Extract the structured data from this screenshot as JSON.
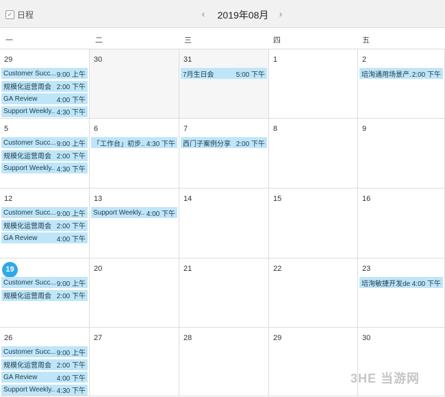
{
  "app": {
    "label": "日程",
    "icon": "check-square-icon"
  },
  "header": {
    "month": "2019年08月",
    "prev_icon": "‹",
    "next_icon": "›"
  },
  "weekdays": [
    "一",
    "二",
    "三",
    "四",
    "五"
  ],
  "colors": {
    "event_bg": "#bfe6f8",
    "today": "#32a8e6",
    "muted_cell": "#f6f6f6"
  },
  "weeks": [
    {
      "days": [
        {
          "day": "29",
          "muted": false,
          "events": [
            {
              "title": "Customer Succ...",
              "time": "9:00 上午"
            },
            {
              "title": "规模化运营周会",
              "time": "2:00 下午"
            },
            {
              "title": "GA Review",
              "time": "4:00 下午"
            },
            {
              "title": "Support Weekly...",
              "time": "4:30 下午"
            }
          ]
        },
        {
          "day": "30",
          "muted": true,
          "events": []
        },
        {
          "day": "31",
          "muted": true,
          "events": [
            {
              "title": "7月生日会",
              "time": "5:00 下午"
            }
          ]
        },
        {
          "day": "1",
          "muted": false,
          "events": []
        },
        {
          "day": "2",
          "muted": false,
          "events": [
            {
              "title": "培洵通用场景产...",
              "time": "2:00 下午"
            }
          ]
        }
      ]
    },
    {
      "days": [
        {
          "day": "5",
          "muted": false,
          "events": [
            {
              "title": "Customer Succ...",
              "time": "9:00 上午"
            },
            {
              "title": "规模化运营周会",
              "time": "2:00 下午"
            },
            {
              "title": "Support Weekly...",
              "time": "4:30 下午"
            }
          ]
        },
        {
          "day": "6",
          "muted": false,
          "events": [
            {
              "title": "「工作台」初步...",
              "time": "4:30 下午"
            }
          ]
        },
        {
          "day": "7",
          "muted": false,
          "events": [
            {
              "title": "西门子案例分享",
              "time": "2:00 下午"
            }
          ]
        },
        {
          "day": "8",
          "muted": false,
          "events": []
        },
        {
          "day": "9",
          "muted": false,
          "events": []
        }
      ]
    },
    {
      "days": [
        {
          "day": "12",
          "muted": false,
          "events": [
            {
              "title": "Customer Succ...",
              "time": "9:00 上午"
            },
            {
              "title": "规模化运营周会",
              "time": "2:00 下午"
            },
            {
              "title": "GA Review",
              "time": "4:00 下午"
            }
          ]
        },
        {
          "day": "13",
          "muted": false,
          "events": [
            {
              "title": "Support Weekly...",
              "time": "4:00 下午"
            }
          ]
        },
        {
          "day": "14",
          "muted": false,
          "events": []
        },
        {
          "day": "15",
          "muted": false,
          "events": []
        },
        {
          "day": "16",
          "muted": false,
          "events": []
        }
      ]
    },
    {
      "days": [
        {
          "day": "19",
          "muted": false,
          "today": true,
          "events": [
            {
              "title": "Customer Succ...",
              "time": "9:00 上午"
            },
            {
              "title": "规模化运营周会",
              "time": "2:00 下午"
            }
          ]
        },
        {
          "day": "20",
          "muted": false,
          "events": []
        },
        {
          "day": "21",
          "muted": false,
          "events": []
        },
        {
          "day": "22",
          "muted": false,
          "events": []
        },
        {
          "day": "23",
          "muted": false,
          "events": [
            {
              "title": "培洵敏捷开发de...",
              "time": "4:00 下午"
            }
          ]
        }
      ]
    },
    {
      "days": [
        {
          "day": "26",
          "muted": false,
          "events": [
            {
              "title": "Customer Succ...",
              "time": "9:00 上午"
            },
            {
              "title": "规模化运营周会",
              "time": "2:00 下午"
            },
            {
              "title": "GA Review",
              "time": "4:00 下午"
            },
            {
              "title": "Support Weekly...",
              "time": "4:30 下午"
            }
          ]
        },
        {
          "day": "27",
          "muted": false,
          "events": []
        },
        {
          "day": "28",
          "muted": false,
          "events": []
        },
        {
          "day": "29",
          "muted": false,
          "events": []
        },
        {
          "day": "30",
          "muted": false,
          "events": []
        }
      ]
    }
  ],
  "watermark": "3HE 当游网"
}
